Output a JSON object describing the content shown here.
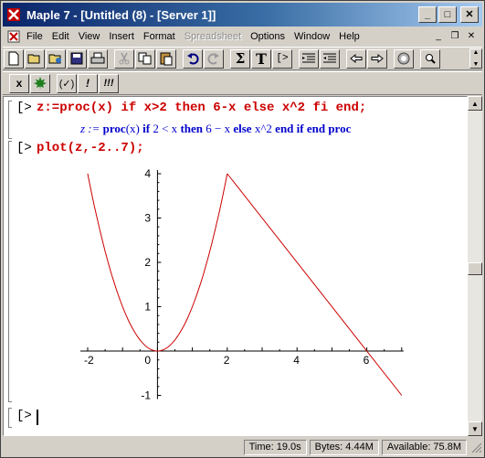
{
  "window": {
    "title": "Maple 7  - [Untitled (8) - [Server 1]]",
    "min_glyph": "_",
    "max_glyph": "□",
    "close_glyph": "✕"
  },
  "menu": {
    "items": [
      "File",
      "Edit",
      "View",
      "Insert",
      "Format",
      "Spreadsheet",
      "Options",
      "Window",
      "Help"
    ],
    "disabled": [
      "Spreadsheet"
    ],
    "mdi_min": "_",
    "mdi_restore": "❐",
    "mdi_close": "✕"
  },
  "toolbar": {
    "sum_label": "Σ",
    "text_label": "T",
    "prompt_label": "[>",
    "stop_label": "x",
    "eval_label": "(✓)",
    "bang_label": "!",
    "bangs_label": "!!!"
  },
  "worksheet": {
    "prompt": "[>",
    "cmd1": "z:=proc(x) if x>2 then 6-x else x^2 fi end;",
    "output1": {
      "lhs": "z := ",
      "kw_proc": "proc",
      "arg": "(x)",
      "kw_if": " if ",
      "cond": "2 < x",
      "kw_then": " then ",
      "then_expr": "6 − x",
      "kw_else": " else ",
      "else_expr": "x^2",
      "kw_end": " end if end proc"
    },
    "cmd2": "plot(z,-2..7);",
    "prompt3": "[>"
  },
  "chart_data": {
    "type": "line",
    "title": "",
    "xlabel": "",
    "ylabel": "",
    "xlim": [
      -2,
      7
    ],
    "ylim": [
      -1,
      4
    ],
    "xticks": [
      "-2",
      "0",
      "2",
      "4",
      "6"
    ],
    "yticks": [
      "4",
      "3",
      "2",
      "1",
      "0",
      "-1"
    ],
    "grid": false,
    "color": "#cc0000",
    "series": [
      {
        "x": [
          -2,
          -1.5,
          -1,
          -0.5,
          0,
          0.5,
          1,
          1.5,
          2
        ],
        "y": [
          4,
          2.25,
          1,
          0.25,
          0,
          0.25,
          1,
          2.25,
          4
        ]
      },
      {
        "x": [
          2,
          7
        ],
        "y": [
          4,
          -1
        ]
      }
    ]
  },
  "status": {
    "time": "Time: 19.0s",
    "bytes": "Bytes: 4.44M",
    "available": "Available: 75.8M"
  }
}
